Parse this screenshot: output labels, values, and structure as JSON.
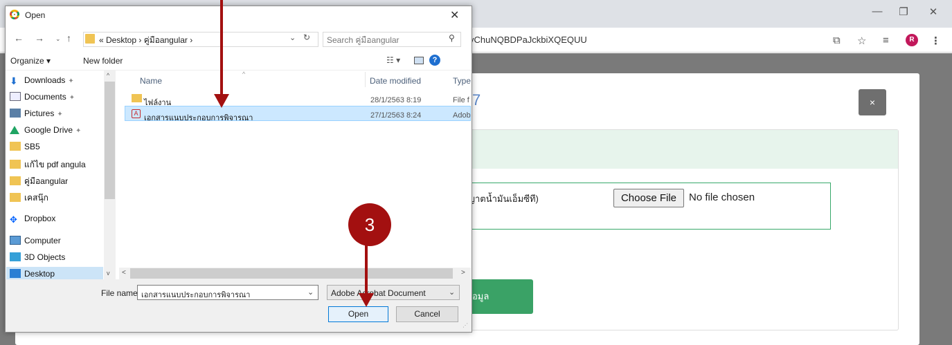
{
  "browser": {
    "url_fragment": "yChuNQBDPaJckbiXQEQUU",
    "avatar_letter": "R",
    "window_buttons": {
      "minimize": "—",
      "restore": "❐",
      "close": "✕"
    },
    "toolbar_icons": [
      "translate-icon",
      "star-icon",
      "reading-list-icon",
      "profile-avatar",
      "menu-icon"
    ]
  },
  "modal": {
    "number_fragment": "7",
    "close_label": "×",
    "upload_label_fragment": "นุญาตน้ำมันเอ็มซีที)",
    "choose_file_label": "Choose File",
    "no_file_text": "No file chosen",
    "save_button_fragment": "อมูล",
    "accent_color": "#3aa266"
  },
  "dialog": {
    "title": "Open",
    "close_label": "✕",
    "path": "« Desktop  ›  คู่มือangular  ›",
    "search_placeholder": "Search คู่มือangular",
    "organize_label": "Organize ▾",
    "new_folder_label": "New folder",
    "help_label": "?",
    "nav_items": [
      {
        "label": "Downloads",
        "icon": "download-icon",
        "pinned": true
      },
      {
        "label": "Documents",
        "icon": "documents-icon",
        "pinned": true
      },
      {
        "label": "Pictures",
        "icon": "pictures-icon",
        "pinned": true
      },
      {
        "label": "Google Drive",
        "icon": "google-drive-icon",
        "pinned": true
      },
      {
        "label": "SB5",
        "icon": "folder-icon",
        "pinned": false
      },
      {
        "label": "แก้ไข pdf angula",
        "icon": "folder-icon",
        "pinned": false
      },
      {
        "label": "คู่มือangular",
        "icon": "folder-icon",
        "pinned": false
      },
      {
        "label": "เคสนุ๊ก",
        "icon": "folder-icon",
        "pinned": false
      },
      {
        "label": "Dropbox",
        "icon": "dropbox-icon",
        "pinned": false
      },
      {
        "label": "Computer",
        "icon": "computer-icon",
        "pinned": false
      },
      {
        "label": "3D Objects",
        "icon": "3d-objects-icon",
        "pinned": false
      },
      {
        "label": "Desktop",
        "icon": "desktop-icon",
        "pinned": false
      }
    ],
    "columns": {
      "name": "Name",
      "date": "Date modified",
      "type": "Type"
    },
    "files": [
      {
        "name": "ไฟล์งาน",
        "date": "28/1/2563 8:19",
        "type": "File f",
        "icon": "folder-icon"
      },
      {
        "name": "เอกสารแนบประกอบการพิจารณา",
        "date": "27/1/2563 8:24",
        "type": "Adob",
        "icon": "pdf-icon"
      }
    ],
    "file_name_label": "File name:",
    "file_name_value": "เอกสารแนบประกอบการพิจารณา",
    "file_type": "Adobe Acrobat Document",
    "open_label": "Open",
    "cancel_label": "Cancel"
  },
  "annotation": {
    "step_number": "3",
    "color": "#a31010"
  }
}
